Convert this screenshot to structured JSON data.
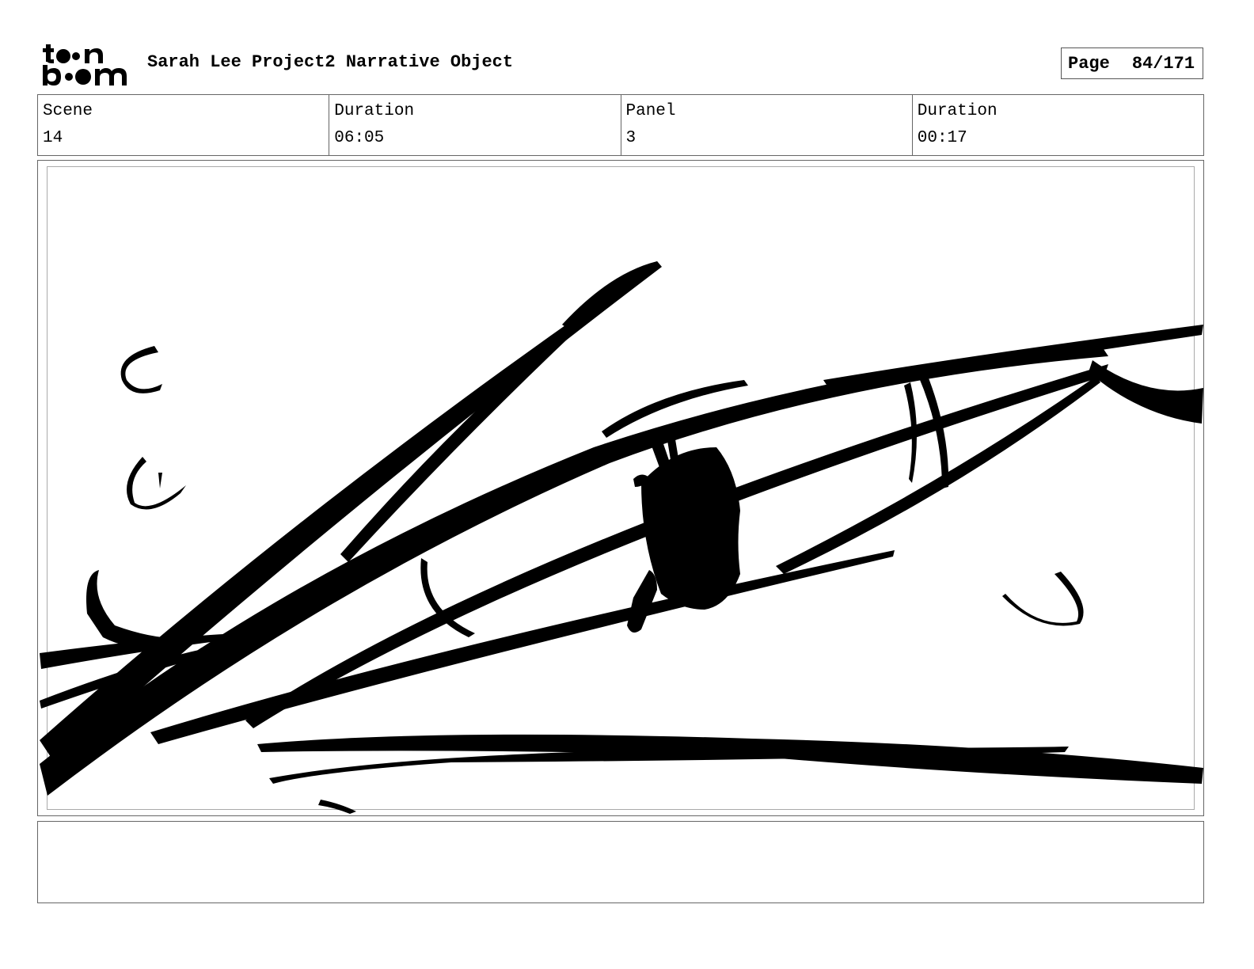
{
  "logo": {
    "line1": "toon",
    "line2": "boom",
    "icon": "toonboom-logo"
  },
  "header": {
    "title": "Sarah Lee Project2 Narrative Object",
    "page_label": "Page",
    "page_value": "84/171"
  },
  "info": {
    "scene_label": "Scene",
    "scene_value": "14",
    "duration_label": "Duration",
    "duration_value": "06:05",
    "panel_label": "Panel",
    "panel_value": "3",
    "panel_duration_label": "Duration",
    "panel_duration_value": "00:17"
  },
  "panel": {
    "content": "black-ink-sketch-of-eye"
  },
  "notes": {
    "text": ""
  }
}
